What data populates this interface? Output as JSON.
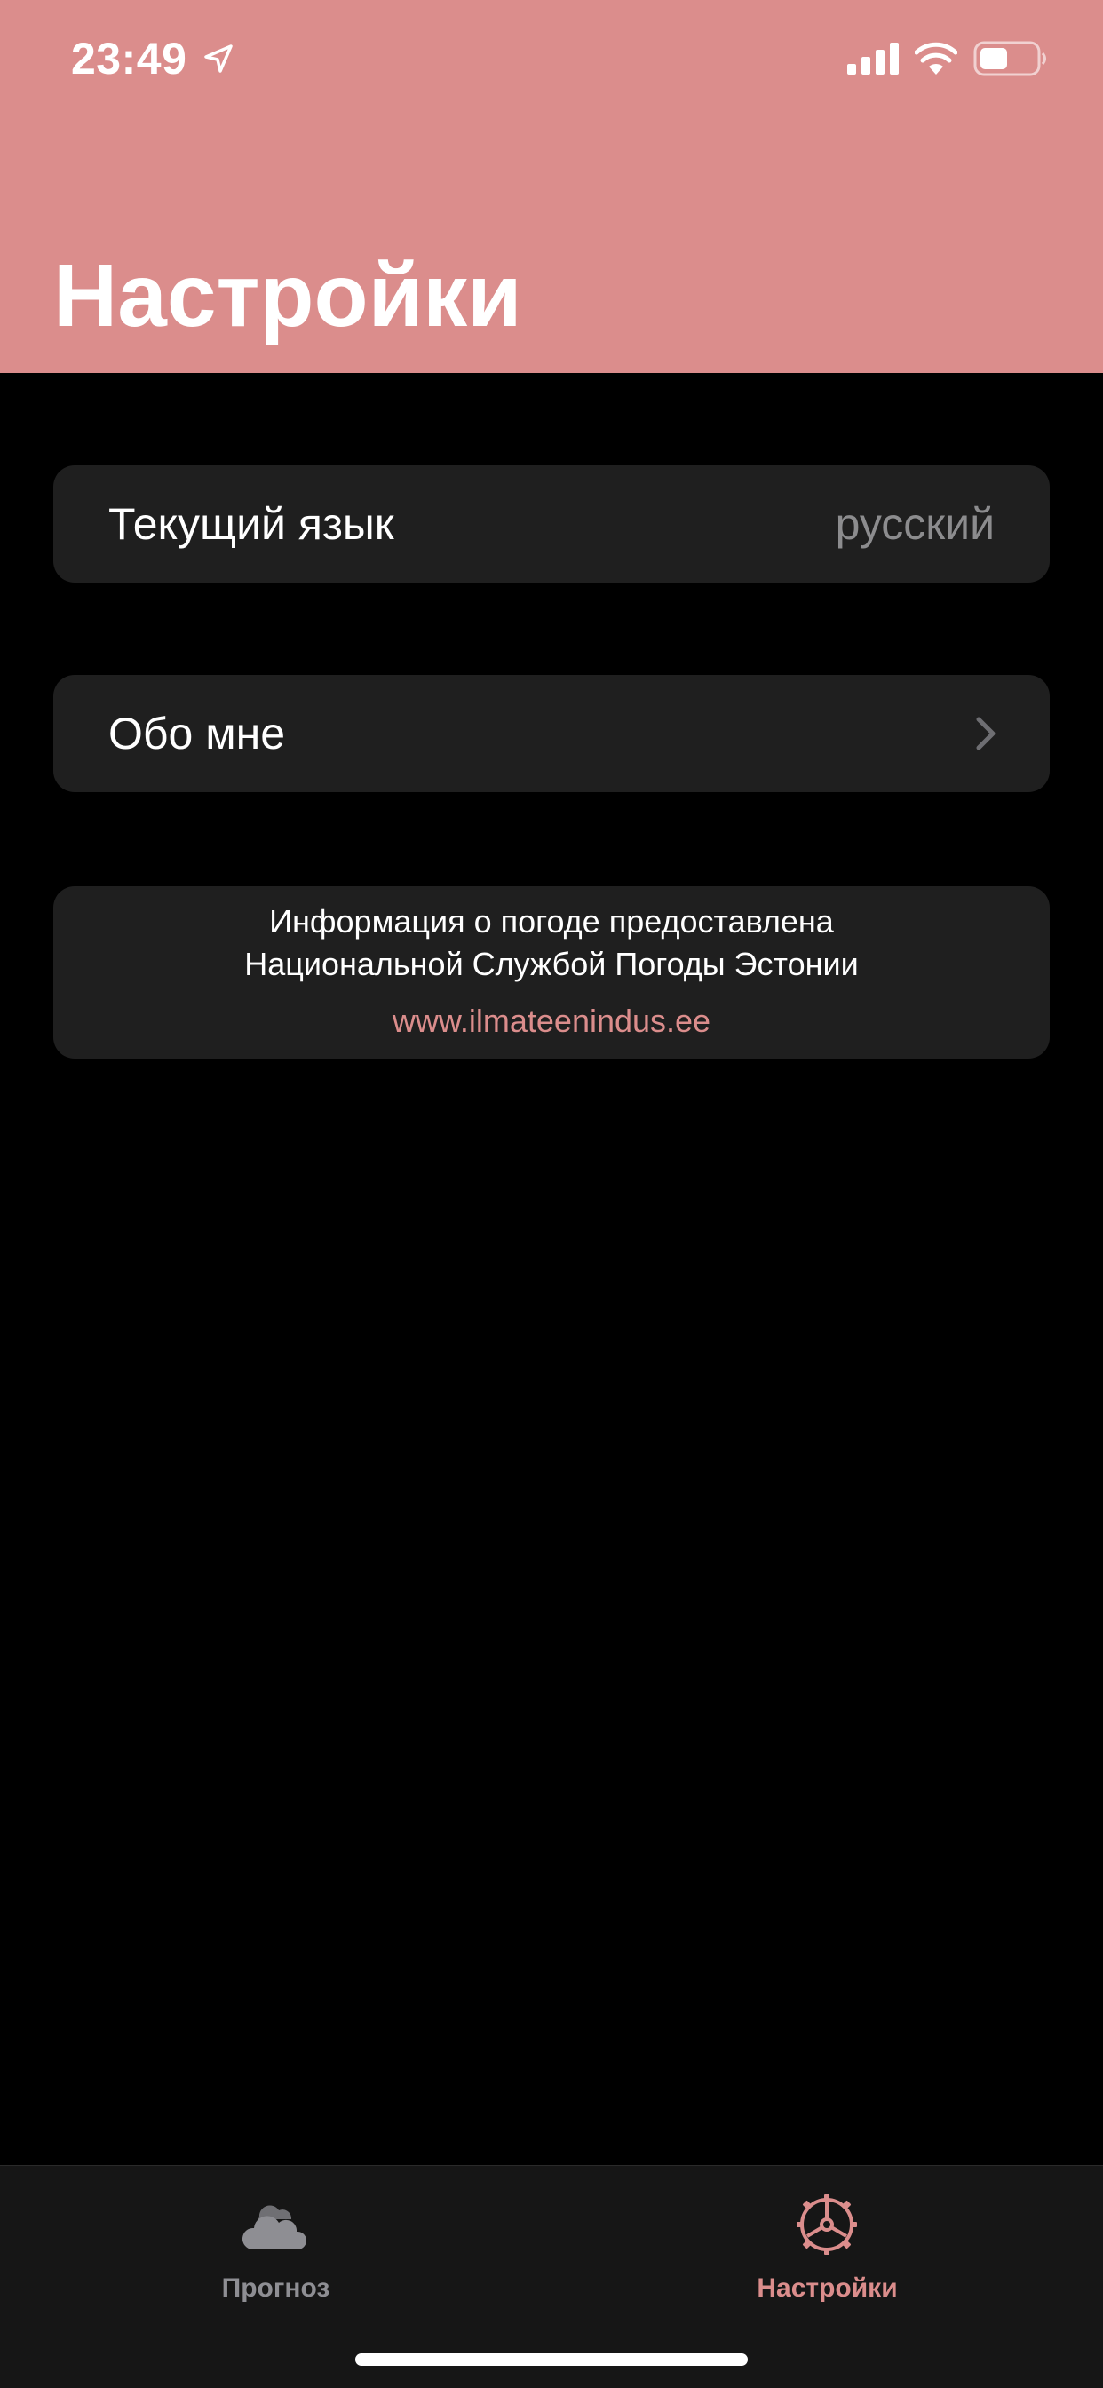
{
  "status_bar": {
    "time": "23:49",
    "icons": [
      "location-arrow-icon",
      "cellular-signal-icon",
      "wifi-icon",
      "battery-icon"
    ]
  },
  "header": {
    "title": "Настройки",
    "background_color": "#DB8D8C"
  },
  "settings": {
    "language": {
      "label": "Текущий язык",
      "value": "русский"
    },
    "about": {
      "label": "Обо мне",
      "icon": "chevron-right-icon"
    },
    "info": {
      "line1": "Информация о погоде предоставлена",
      "line2": "Национальной Службой Погоды Эстонии",
      "link": "www.ilmateenindus.ee"
    }
  },
  "tab_bar": {
    "tabs": [
      {
        "label": "Прогноз",
        "icon": "cloud-icon",
        "selected": false,
        "color": "#8E8E93"
      },
      {
        "label": "Настройки",
        "icon": "gear-icon",
        "selected": true,
        "color": "#DB8D8C"
      }
    ]
  },
  "colors": {
    "accent": "#DB8D8C",
    "card_background": "#1F1F1F",
    "secondary_text": "#8C8C8E",
    "background": "#000000"
  }
}
